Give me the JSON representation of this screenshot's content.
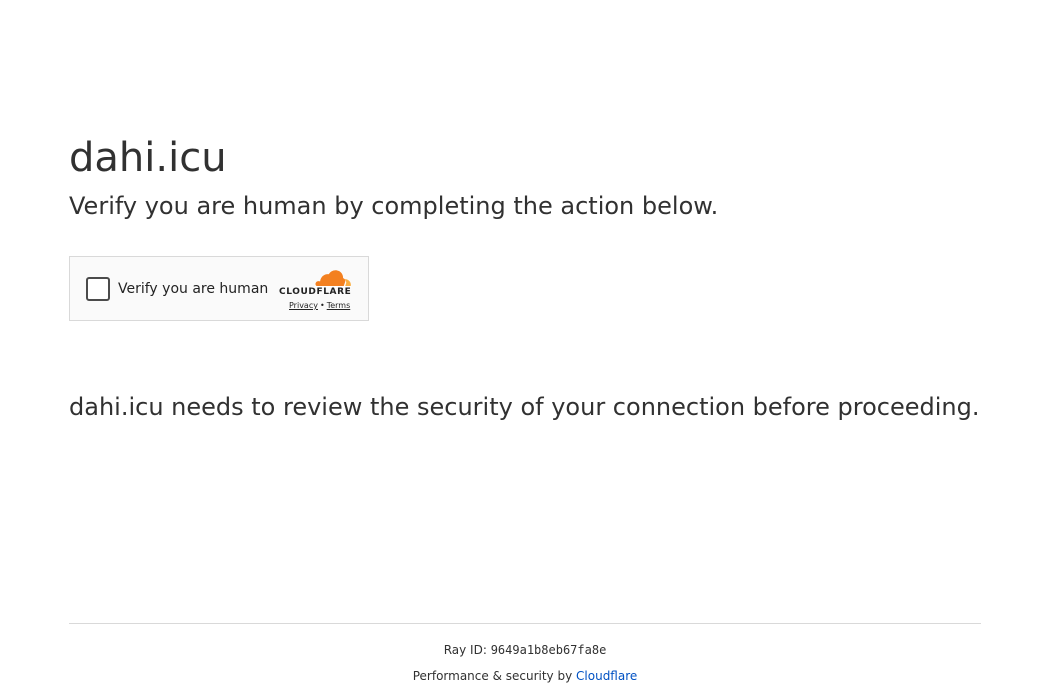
{
  "site": {
    "domain": "dahi.icu"
  },
  "challenge": {
    "heading": "Verify you are human by completing the action below.",
    "message": "dahi.icu needs to review the security of your connection before proceeding."
  },
  "widget": {
    "checkbox_label": "Verify you are human",
    "brand_name": "CLOUDFLARE",
    "privacy_link": "Privacy",
    "separator": "•",
    "terms_link": "Terms",
    "brand_orange": "#f38020",
    "brand_light_orange": "#faae40"
  },
  "footer": {
    "ray_label": "Ray ID:",
    "ray_id": "9649a1b8eb67fa8e",
    "performance_prefix": "Performance & security by",
    "cloudflare_link": "Cloudflare",
    "link_color": "#0051c3"
  }
}
